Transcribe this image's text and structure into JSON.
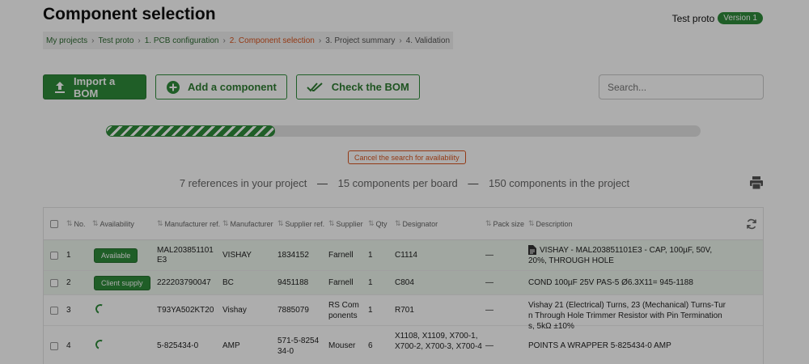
{
  "header": {
    "title": "Component selection",
    "project_name": "Test proto",
    "version": "Version 1"
  },
  "breadcrumb": [
    {
      "label": "My projects",
      "state": "done"
    },
    {
      "label": "Test proto",
      "state": "done"
    },
    {
      "label": "1. PCB configuration",
      "state": "done"
    },
    {
      "label": "2. Component selection",
      "state": "active"
    },
    {
      "label": "3. Project summary",
      "state": "future"
    },
    {
      "label": "4. Validation",
      "state": "future"
    }
  ],
  "toolbar": {
    "import_label": "Import a BOM",
    "add_label": "Add a component",
    "check_label": "Check the BOM",
    "search_placeholder": "Search..."
  },
  "progress": {
    "fraction": 0.285
  },
  "cancel_label": "Cancel the search for availability",
  "summary": {
    "references": "7 references in your project",
    "per_board": "15 components per board",
    "in_project": "150 components in the project"
  },
  "colors": {
    "brand_green": "#2e8b3a",
    "accent_orange": "#d9551f"
  },
  "table": {
    "columns": {
      "no": "No.",
      "availability": "Availability",
      "mfr_ref": "Manufacturer ref.",
      "manufacturer": "Manufacturer",
      "supplier_ref": "Supplier ref.",
      "supplier": "Supplier",
      "qty": "Qty",
      "designator": "Designator",
      "pack_size": "Pack size",
      "description": "Description"
    },
    "rows": [
      {
        "no": "1",
        "availability": "Available",
        "status": "badge",
        "mfr_ref": "MAL203851101E3",
        "manufacturer": "VISHAY",
        "supplier_ref": "1834152",
        "supplier": "Farnell",
        "qty": "1",
        "designator": "C1114",
        "pack_size": "—",
        "description": "VISHAY - MAL203851101E3 - CAP, 100µF, 50V, 20%, THROUGH HOLE",
        "doc_icon": true,
        "highlight": true
      },
      {
        "no": "2",
        "availability": "Client supply",
        "status": "badge",
        "mfr_ref": "222203790047",
        "manufacturer": "BC",
        "supplier_ref": "9451188",
        "supplier": "Farnell",
        "qty": "1",
        "designator": "C804",
        "pack_size": "—",
        "description": "COND 100µF 25V PAS-5 Ø6.3X11= 945-1188",
        "doc_icon": false,
        "highlight": true
      },
      {
        "no": "3",
        "availability": "",
        "status": "loading",
        "mfr_ref": "T93YA502KT20",
        "manufacturer": "Vishay",
        "supplier_ref": "7885079",
        "supplier": "RS Components",
        "qty": "1",
        "designator": "R701",
        "pack_size": "—",
        "description": "Vishay 21 (Electrical) Turns, 23 (Mechanical) Turns-Turn Through Hole Trimmer Resistor with Pin Terminations, 5kΩ ±10%",
        "doc_icon": false,
        "highlight": false
      },
      {
        "no": "4",
        "availability": "",
        "status": "loading",
        "mfr_ref": "5-825434-0",
        "manufacturer": "AMP",
        "supplier_ref": "571-5-825434-0",
        "supplier": "Mouser",
        "qty": "6",
        "designator": "X1108, X1109, X700-1, X700-2, X700-3, X700-4",
        "pack_size": "—",
        "description": "POINTS A WRAPPER 5-825434-0 AMP",
        "doc_icon": false,
        "highlight": false
      }
    ]
  }
}
